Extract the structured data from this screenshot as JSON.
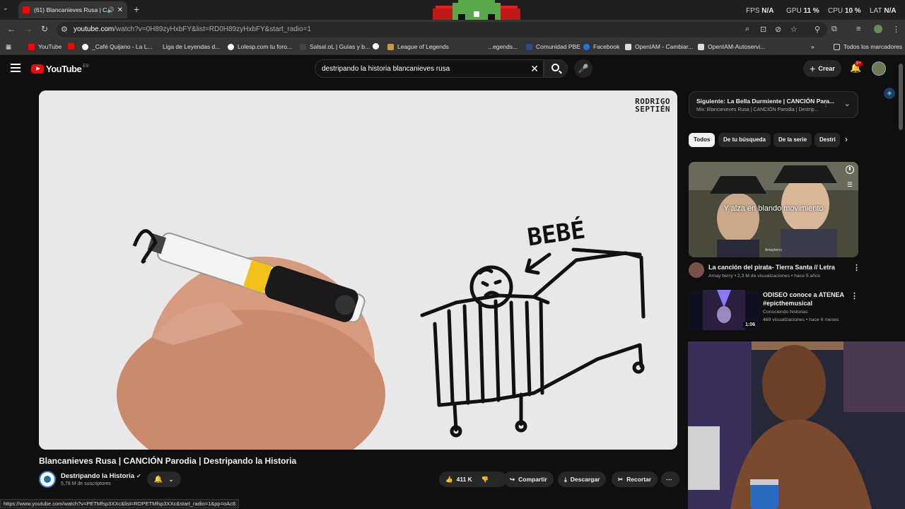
{
  "browser": {
    "tab_title": "(61) Blancanieves Rusa | CA",
    "url_main": "youtube.com",
    "url_rest": "/watch?v=0H89zyHxbFY&list=RD0H89zyHxbFY&start_radio=1",
    "hud": {
      "fps_label": "FPS",
      "fps_value": "N/A",
      "gpu_label": "GPU",
      "gpu_value": "11 %",
      "cpu_label": "CPU",
      "cpu_value": "10 %",
      "lat_label": "LAT",
      "lat_value": "N/A"
    },
    "bookmarks": [
      "YouTube",
      "_Café Quijano - La L...",
      "Liga de Leyendas d...",
      "Lolesp.com tu foro...",
      "Salsal.oL | Guías y b...",
      "League of Legends",
      "...egends...",
      "Comunidad PBE",
      "Facebook",
      "OpenIAM - Cambiar...",
      "OpenIAM-Autoservi..."
    ],
    "all_bookmarks": "Todos los marcadores",
    "status_url": "https://www.youtube.com/watch?v=PETMfsp3XXc&list=RDPETMfsp3XXc&start_radio=1&pp=oAc8"
  },
  "youtube": {
    "logo": "YouTube",
    "country": "ES",
    "search_query": "destripando la historia blancanieves rusa",
    "create_label": "Crear",
    "notif_badge": "9+"
  },
  "video": {
    "author_watermark_1": "RODRIGO",
    "author_watermark_2": "SEPTIÉN",
    "drawing_label": "BEBÉ",
    "title": "Blancanieves Rusa | CANCIÓN Parodia | Destripando la Historia",
    "channel": "Destripando la Historia",
    "subscribers": "5,78 M de suscriptores",
    "likes": "411 K",
    "share": "Compartir",
    "download": "Descargar",
    "clip": "Recortar"
  },
  "sidebar": {
    "up_next_title": "Siguiente: La Bella Durmiente | CANCIÓN Para...",
    "up_next_sub": "Mix: Blancanieves Rusa | CANCIÓN Parodia | Destrip...",
    "chips": [
      "Todos",
      "De tu búsqueda",
      "De la serie",
      "Destri"
    ],
    "items": [
      {
        "caption": "Y alza en blando movimiento",
        "sig": "Amayberry",
        "title": "La canción del pirata- Tierra Santa // Letra",
        "meta": "Amay berry • 2,3 M de visualizaciones • hace 5 años"
      },
      {
        "title_1": "ODISEO conoce a ATENEA",
        "title_2": "#epicthemusical",
        "channel": "Conociendo historias",
        "meta": "469 visualizaciones • hace 6 meses",
        "duration": "1:06"
      }
    ]
  }
}
